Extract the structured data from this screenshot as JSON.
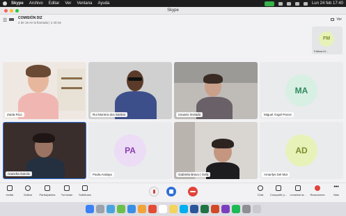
{
  "menubar": {
    "app": "Skype",
    "items": [
      "Archivo",
      "Editar",
      "Ver",
      "Ventana",
      "Ayuda"
    ],
    "datetime": "Lun 24 feb 17:40"
  },
  "window": {
    "title": "Skype"
  },
  "call": {
    "name": "COMISIÓN DIZ",
    "subtitle": "2 de 16 en la llamada | 1:40:16",
    "view_label": "Ver"
  },
  "self_preview": {
    "initials": "FM",
    "name": "Fátima M..."
  },
  "participants": [
    {
      "name": "Zaida Rico",
      "type": "video"
    },
    {
      "name": "Rui Moreira dos Santos",
      "type": "video"
    },
    {
      "name": "Usuario invitado",
      "type": "video"
    },
    {
      "name": "Miguel Ángel Pazos",
      "type": "avatar",
      "initials": "MA"
    },
    {
      "name": "Arancha García",
      "type": "video"
    },
    {
      "name": "Paola Andaya",
      "type": "avatar",
      "initials": "PA"
    },
    {
      "name": "Gabriela Bravo | Oxfa",
      "type": "video"
    },
    {
      "name": "Amarilys Del Mar",
      "type": "avatar",
      "initials": "AD"
    }
  ],
  "toolbar": {
    "invite": "Invitar",
    "record": "Grabar",
    "participants": "Participantes",
    "live": "Turnicam",
    "subtitles": "Subtítulos",
    "chat": "Chat",
    "share": "Compartir p...",
    "raise_hand": "Levantar la...",
    "reactions": "Reacciones",
    "more": "Más"
  },
  "colors": {
    "accent": "#2f6fd8",
    "end_call": "#e0443b",
    "camera_indicator": "#38b34a",
    "avatar_green_bg": "#e6f2b8",
    "avatar_green_fg": "#7b8d2c",
    "avatar_purple_bg": "#ecdcf5",
    "avatar_purple_fg": "#8a3fae"
  }
}
